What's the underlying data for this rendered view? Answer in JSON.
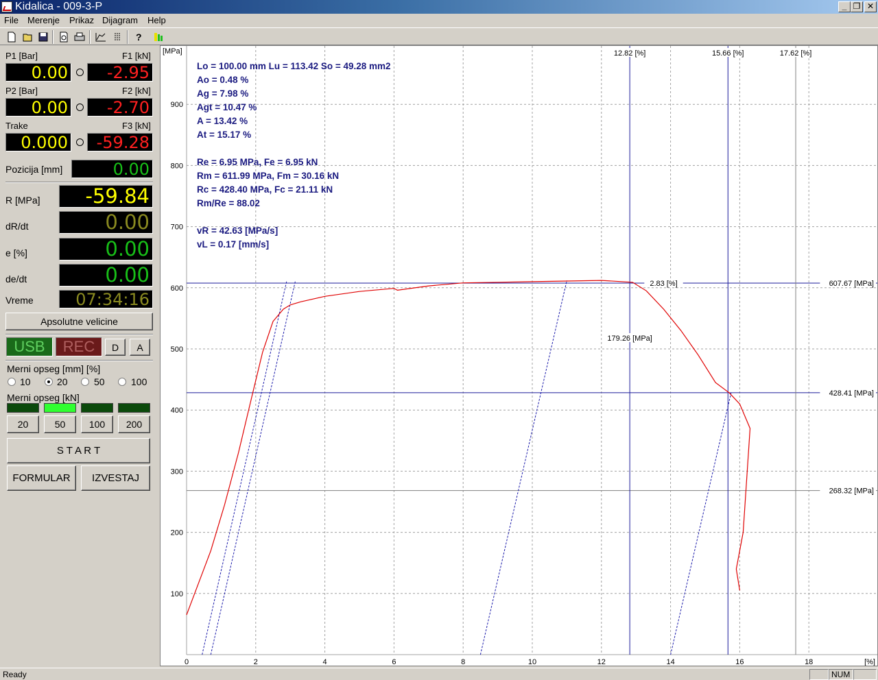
{
  "window": {
    "title": "Kidalica - 009-3-P"
  },
  "menu": [
    "File",
    "Merenje",
    "Prikaz",
    "Dijagram",
    "Help"
  ],
  "toolbar": {
    "icons": [
      "new-icon",
      "open-icon",
      "save-icon",
      "print-preview-icon",
      "print-icon",
      "chart-icon",
      "legend-icon",
      "help-icon",
      "signal-icon"
    ]
  },
  "left": {
    "p1_label": "P1 [Bar]",
    "f1_label": "F1 [kN]",
    "p1_value": "0.00",
    "f1_value": "-2.95",
    "p2_label": "P2 [Bar]",
    "f2_label": "F2 [kN]",
    "p2_value": "0.00",
    "f2_value": "-2.70",
    "trake_label": "Trake",
    "f3_label": "F3 [kN]",
    "trake_value": "0.000",
    "f3_value": "-59.28",
    "pozicija_label": "Pozicija [mm]",
    "pozicija_value": "0.00",
    "r_label": "R [MPa]",
    "r_value": "-59.84",
    "drdt_label": "dR/dt",
    "drdt_value": "0.00",
    "e_label": "e [%]",
    "e_value": "0.00",
    "dedt_label": "de/dt",
    "dedt_value": "0.00",
    "vreme_label": "Vreme",
    "vreme_value": "07:34:16",
    "apsolutne_button": "Apsolutne velicine",
    "usb": "USB",
    "rec": "REC",
    "d_button": "D",
    "a_button": "A",
    "merni_mm_label": "Merni opseg [mm] [%]",
    "merni_mm_options": [
      "10",
      "20",
      "50",
      "100"
    ],
    "merni_mm_selected": "20",
    "merni_kn_label": "Merni opseg [kN]",
    "merni_kn_buttons": [
      "20",
      "50",
      "100",
      "200"
    ],
    "merni_kn_active": "50",
    "start_button": "S T A R T",
    "formular_button": "FORMULAR",
    "izvestaj_button": "IZVESTAJ"
  },
  "colors": {
    "accent_text": "#1a1a80",
    "curve": "#e00000",
    "marker_line": "#1a1a9a",
    "gray_line": "#808080"
  },
  "chart_data": {
    "type": "line",
    "xlabel": "[%]",
    "ylabel": "[MPa]",
    "xlim": [
      0,
      19.5
    ],
    "ylim": [
      0,
      1000
    ],
    "x_ticks": [
      0,
      2,
      4,
      6,
      8,
      10,
      12,
      14,
      16,
      18
    ],
    "y_ticks": [
      100,
      200,
      300,
      400,
      500,
      600,
      700,
      800,
      900
    ],
    "grid": true,
    "stats_lines": [
      "Lo = 100.00 mm  Lu = 113.42  So = 49.28 mm2",
      "Ao  = 0.48 %",
      "Ag  = 7.98 %",
      "Agt = 10.47 %",
      "A   = 13.42 %",
      "At  = 15.17 %",
      "",
      "Re  = 6.95 MPa, Fe = 6.95 kN",
      "Rm  = 611.99 MPa, Fm = 30.16 kN",
      "Rc  = 428.40 MPa, Fc = 21.11 kN",
      "Rm/Re = 88.02",
      "",
      "vR = 42.63 [MPa/s]",
      "vL = 0.17 [mm/s]"
    ],
    "series": [
      {
        "type": "curve",
        "x": [
          0,
          0.3,
          0.7,
          1.1,
          1.5,
          1.9,
          2.2,
          2.5,
          2.8,
          3.0,
          3.3,
          4.0,
          5.0,
          6.0,
          6.1,
          7.0,
          8.0,
          9.0,
          10.0,
          11.0,
          12.0,
          12.9,
          13.3,
          13.8,
          14.3,
          14.8,
          15.3,
          15.7,
          16.0,
          16.3,
          16.1,
          15.9,
          16.0
        ],
        "y": [
          65,
          110,
          170,
          245,
          330,
          425,
          495,
          545,
          565,
          572,
          577,
          586,
          594,
          599,
          596,
          603,
          608,
          609,
          610,
          611,
          612,
          609,
          595,
          565,
          530,
          490,
          445,
          428,
          410,
          370,
          200,
          140,
          105
        ]
      }
    ],
    "unloading_lines": [
      {
        "x": [
          0.45,
          2.9
        ],
        "y": [
          0,
          612
        ]
      },
      {
        "x": [
          0.7,
          3.15
        ],
        "y": [
          0,
          612
        ]
      },
      {
        "x": [
          8.5,
          11.0
        ],
        "y": [
          0,
          612
        ]
      },
      {
        "x": [
          14.0,
          15.75
        ],
        "y": [
          0,
          428
        ]
      }
    ],
    "markers_vertical": [
      {
        "x": 12.82,
        "label": "12.82 [%]",
        "style": "blue"
      },
      {
        "x": 15.66,
        "label": "15.66 [%]",
        "style": "blue"
      },
      {
        "x": 17.62,
        "label": "17.62 [%]",
        "style": "gray"
      }
    ],
    "markers_horizontal": [
      {
        "y": 607.67,
        "label": "607.67 [MPa]",
        "style": "blue"
      },
      {
        "y": 428.41,
        "label": "428.41 [MPa]",
        "style": "blue"
      },
      {
        "y": 268.32,
        "label": "268.32 [MPa]",
        "style": "gray"
      }
    ],
    "annotations": [
      {
        "x": 13.8,
        "y": 607.67,
        "text": "2.83 [%]"
      },
      {
        "x": 12.82,
        "y": 518,
        "text": "179.26 [MPa]"
      }
    ]
  },
  "status": {
    "text": "Ready",
    "num": "NUM"
  }
}
